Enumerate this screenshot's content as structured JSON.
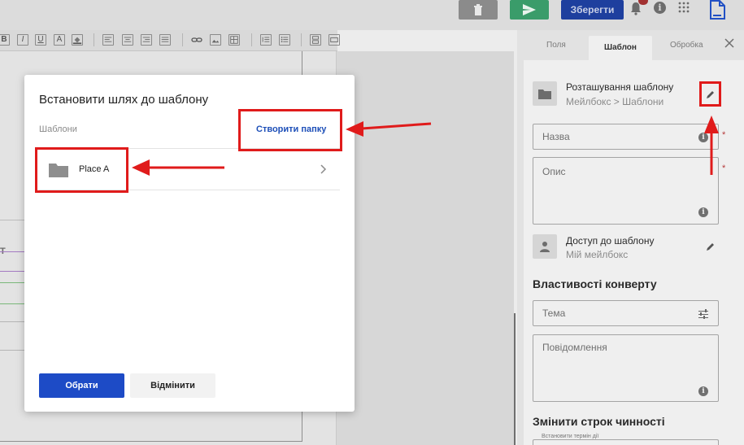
{
  "toolbar": {
    "save_label": "Зберегти",
    "trash_icon": "trash-icon",
    "send_icon": "send-icon",
    "bell_icon": "bell-icon",
    "info_icon": "info-icon",
    "apps_icon": "apps-grid-icon",
    "doc_icon": "document-icon",
    "info_glyph": "i"
  },
  "format_bar": {
    "items": [
      "B",
      "I",
      "U",
      "A"
    ]
  },
  "editor": {
    "column_letter": "T"
  },
  "panel": {
    "tabs": [
      {
        "label": "Поля"
      },
      {
        "label": "Шаблон"
      },
      {
        "label": "Обробка"
      }
    ],
    "active_tab": "Шаблон",
    "location": {
      "title": "Розташування шаблону",
      "path": "Мейлбокс > Шаблони"
    },
    "name_field": {
      "placeholder": "Назва",
      "required_mark": "*"
    },
    "desc_field": {
      "placeholder": "Опис",
      "required_mark": "*"
    },
    "access": {
      "title": "Доступ до шаблону",
      "value": "Мій мейлбокс"
    },
    "envelope_heading": "Властивості конверту",
    "subject_field": {
      "placeholder": "Тема"
    },
    "message_field": {
      "placeholder": "Повідомлення"
    },
    "validity_heading": "Змінити строк чинності",
    "validity_small_label": "Встановити термін дії"
  },
  "dialog": {
    "title": "Встановити шлях до шаблону",
    "breadcrumb": "Шаблони",
    "create_folder": "Створити папку",
    "folders": [
      {
        "name": "Place A"
      }
    ],
    "select_button": "Обрати",
    "cancel_button": "Відмінити"
  },
  "colors": {
    "primary": "#1d4bc6",
    "save_button": "#1e3f9e",
    "send_button": "#3a9c6a",
    "annotation": "#e01b1b"
  }
}
